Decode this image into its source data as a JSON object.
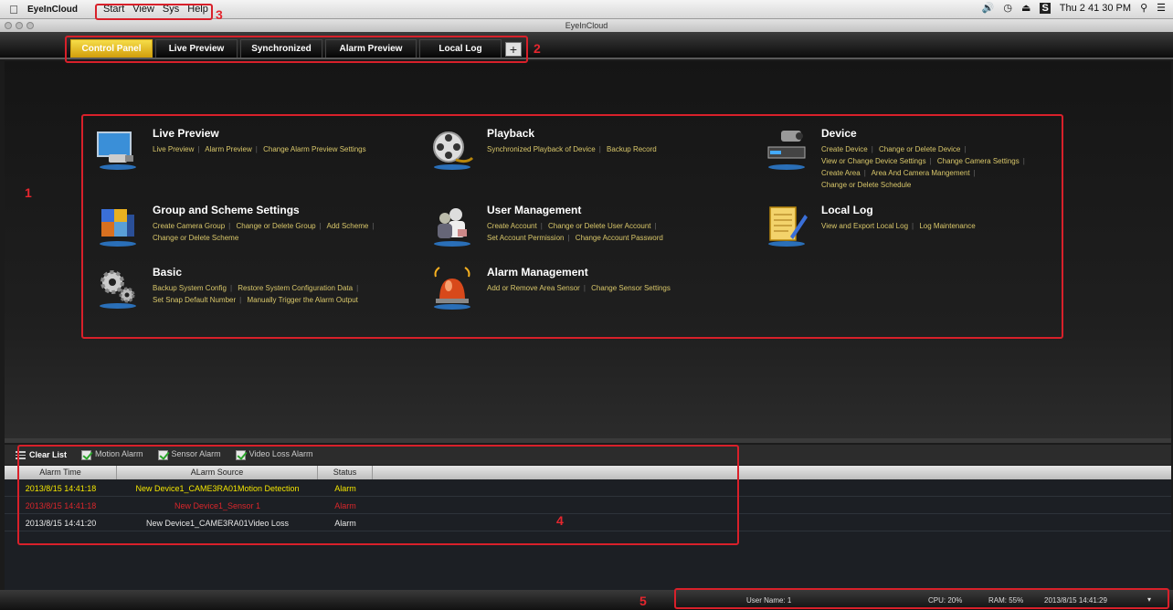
{
  "menubar": {
    "app_name": "EyeInCloud",
    "menus": [
      "Start",
      "View",
      "Sys",
      "Help"
    ],
    "clock": "Thu 2 41 30 PM"
  },
  "window": {
    "title": "EyeInCloud"
  },
  "tabs": [
    "Control Panel",
    "Live Preview",
    "Synchronized",
    "Alarm Preview",
    "Local Log"
  ],
  "tab_add": "+",
  "tiles": [
    {
      "title": "Live Preview",
      "icon": "monitor-camera-icon",
      "links": [
        "Live Preview",
        "Alarm Preview",
        "Change Alarm Preview Settings"
      ]
    },
    {
      "title": "Playback",
      "icon": "film-reel-icon",
      "links": [
        "Synchronized Playback of Device",
        "Backup Record"
      ]
    },
    {
      "title": "Device",
      "icon": "dvr-camera-icon",
      "links": [
        "Create Device",
        "Change or Delete Device",
        "View or Change Device Settings",
        "Change Camera Settings",
        "Create Area",
        "Area And Camera Mangement",
        "Change or Delete Schedule"
      ]
    },
    {
      "title": "Group and Scheme Settings",
      "icon": "grouped-cubes-icon",
      "links": [
        "Create Camera Group",
        "Change or Delete Group",
        "Add Scheme",
        "Change or Delete Scheme"
      ]
    },
    {
      "title": "User Management",
      "icon": "users-icon",
      "links": [
        "Create Account",
        "Change or Delete User Account",
        "Set Account Permission",
        "Change Account Password"
      ]
    },
    {
      "title": "Local Log",
      "icon": "notepad-pencil-icon",
      "links": [
        "View and Export Local Log",
        "Log Maintenance"
      ]
    },
    {
      "title": "Basic",
      "icon": "gears-icon",
      "links": [
        "Backup System Config",
        "Restore System Configuration Data",
        "Set Snap Default Number",
        "Manually Trigger the Alarm Output"
      ]
    },
    {
      "title": "Alarm Management",
      "icon": "alarm-siren-icon",
      "links": [
        "Add or Remove Area Sensor",
        "Change Sensor Settings"
      ]
    }
  ],
  "alarm_panel": {
    "clear_label": "Clear List",
    "filters": [
      "Motion Alarm",
      "Sensor Alarm",
      "Video Loss Alarm"
    ],
    "columns": [
      "Alarm Time",
      "ALarm Source",
      "Status"
    ],
    "rows": [
      {
        "time": "2013/8/15 14:41:18",
        "source": "New Device1_CAME3RA01Motion Detection",
        "status": "Alarm",
        "color": "#f2e500"
      },
      {
        "time": "2013/8/15 14:41:18",
        "source": "New Device1_Sensor 1",
        "status": "Alarm",
        "color": "#d9262b"
      },
      {
        "time": "2013/8/15 14:41:20",
        "source": "New Device1_CAME3RA01Video Loss",
        "status": "Alarm",
        "color": "#e8e8e8"
      }
    ]
  },
  "statusbar": {
    "user": "User Name: 1",
    "cpu": "CPU: 20%",
    "ram": "RAM: 55%",
    "datetime": "2013/8/15 14:41:29"
  },
  "annotations": [
    "1",
    "2",
    "3",
    "4",
    "5"
  ]
}
